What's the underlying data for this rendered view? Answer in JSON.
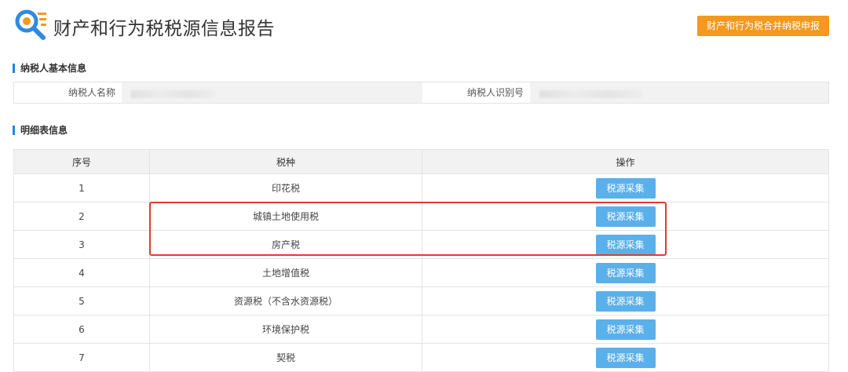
{
  "header": {
    "title": "财产和行为税税源信息报告",
    "merge_button": "财产和行为税合并纳税申报",
    "logo_icon": "search-list-icon"
  },
  "taxpayer_section": {
    "title": "纳税人基本信息",
    "name_label": "纳税人名称",
    "name_value": "",
    "id_label": "纳税人识别号",
    "id_value": ""
  },
  "detail_section": {
    "title": "明细表信息",
    "columns": [
      "序号",
      "税种",
      "操作"
    ],
    "rows": [
      {
        "no": "1",
        "tax": "印花税",
        "action": "税源采集"
      },
      {
        "no": "2",
        "tax": "城镇土地使用税",
        "action": "税源采集"
      },
      {
        "no": "3",
        "tax": "房产税",
        "action": "税源采集"
      },
      {
        "no": "4",
        "tax": "土地增值税",
        "action": "税源采集"
      },
      {
        "no": "5",
        "tax": "资源税（不含水资源税）",
        "action": "税源采集"
      },
      {
        "no": "6",
        "tax": "环境保护税",
        "action": "税源采集"
      },
      {
        "no": "7",
        "tax": "契税",
        "action": "税源采集"
      }
    ]
  },
  "colors": {
    "accent_orange": "#f5981e",
    "button_blue": "#5ab0ea",
    "section_bar": "#1e88e5",
    "highlight_red": "#e53935"
  }
}
